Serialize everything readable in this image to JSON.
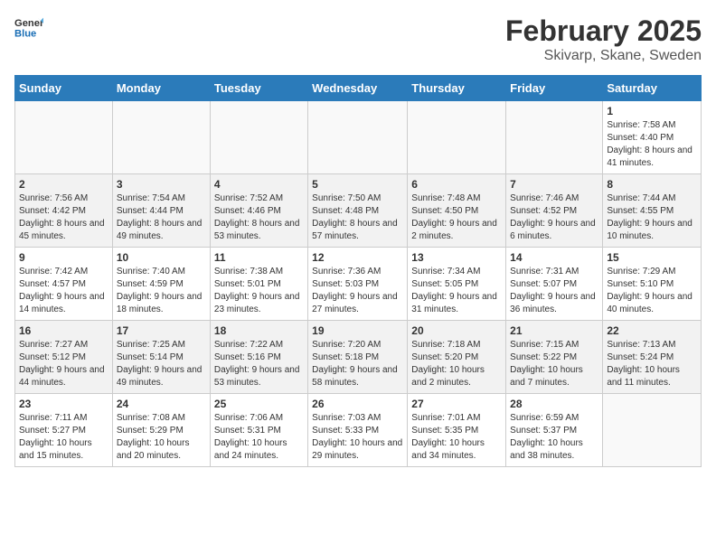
{
  "header": {
    "logo_general": "General",
    "logo_blue": "Blue",
    "month": "February 2025",
    "location": "Skivarp, Skane, Sweden"
  },
  "weekdays": [
    "Sunday",
    "Monday",
    "Tuesday",
    "Wednesday",
    "Thursday",
    "Friday",
    "Saturday"
  ],
  "weeks": [
    [
      {
        "day": "",
        "info": ""
      },
      {
        "day": "",
        "info": ""
      },
      {
        "day": "",
        "info": ""
      },
      {
        "day": "",
        "info": ""
      },
      {
        "day": "",
        "info": ""
      },
      {
        "day": "",
        "info": ""
      },
      {
        "day": "1",
        "info": "Sunrise: 7:58 AM\nSunset: 4:40 PM\nDaylight: 8 hours and 41 minutes."
      }
    ],
    [
      {
        "day": "2",
        "info": "Sunrise: 7:56 AM\nSunset: 4:42 PM\nDaylight: 8 hours and 45 minutes."
      },
      {
        "day": "3",
        "info": "Sunrise: 7:54 AM\nSunset: 4:44 PM\nDaylight: 8 hours and 49 minutes."
      },
      {
        "day": "4",
        "info": "Sunrise: 7:52 AM\nSunset: 4:46 PM\nDaylight: 8 hours and 53 minutes."
      },
      {
        "day": "5",
        "info": "Sunrise: 7:50 AM\nSunset: 4:48 PM\nDaylight: 8 hours and 57 minutes."
      },
      {
        "day": "6",
        "info": "Sunrise: 7:48 AM\nSunset: 4:50 PM\nDaylight: 9 hours and 2 minutes."
      },
      {
        "day": "7",
        "info": "Sunrise: 7:46 AM\nSunset: 4:52 PM\nDaylight: 9 hours and 6 minutes."
      },
      {
        "day": "8",
        "info": "Sunrise: 7:44 AM\nSunset: 4:55 PM\nDaylight: 9 hours and 10 minutes."
      }
    ],
    [
      {
        "day": "9",
        "info": "Sunrise: 7:42 AM\nSunset: 4:57 PM\nDaylight: 9 hours and 14 minutes."
      },
      {
        "day": "10",
        "info": "Sunrise: 7:40 AM\nSunset: 4:59 PM\nDaylight: 9 hours and 18 minutes."
      },
      {
        "day": "11",
        "info": "Sunrise: 7:38 AM\nSunset: 5:01 PM\nDaylight: 9 hours and 23 minutes."
      },
      {
        "day": "12",
        "info": "Sunrise: 7:36 AM\nSunset: 5:03 PM\nDaylight: 9 hours and 27 minutes."
      },
      {
        "day": "13",
        "info": "Sunrise: 7:34 AM\nSunset: 5:05 PM\nDaylight: 9 hours and 31 minutes."
      },
      {
        "day": "14",
        "info": "Sunrise: 7:31 AM\nSunset: 5:07 PM\nDaylight: 9 hours and 36 minutes."
      },
      {
        "day": "15",
        "info": "Sunrise: 7:29 AM\nSunset: 5:10 PM\nDaylight: 9 hours and 40 minutes."
      }
    ],
    [
      {
        "day": "16",
        "info": "Sunrise: 7:27 AM\nSunset: 5:12 PM\nDaylight: 9 hours and 44 minutes."
      },
      {
        "day": "17",
        "info": "Sunrise: 7:25 AM\nSunset: 5:14 PM\nDaylight: 9 hours and 49 minutes."
      },
      {
        "day": "18",
        "info": "Sunrise: 7:22 AM\nSunset: 5:16 PM\nDaylight: 9 hours and 53 minutes."
      },
      {
        "day": "19",
        "info": "Sunrise: 7:20 AM\nSunset: 5:18 PM\nDaylight: 9 hours and 58 minutes."
      },
      {
        "day": "20",
        "info": "Sunrise: 7:18 AM\nSunset: 5:20 PM\nDaylight: 10 hours and 2 minutes."
      },
      {
        "day": "21",
        "info": "Sunrise: 7:15 AM\nSunset: 5:22 PM\nDaylight: 10 hours and 7 minutes."
      },
      {
        "day": "22",
        "info": "Sunrise: 7:13 AM\nSunset: 5:24 PM\nDaylight: 10 hours and 11 minutes."
      }
    ],
    [
      {
        "day": "23",
        "info": "Sunrise: 7:11 AM\nSunset: 5:27 PM\nDaylight: 10 hours and 15 minutes."
      },
      {
        "day": "24",
        "info": "Sunrise: 7:08 AM\nSunset: 5:29 PM\nDaylight: 10 hours and 20 minutes."
      },
      {
        "day": "25",
        "info": "Sunrise: 7:06 AM\nSunset: 5:31 PM\nDaylight: 10 hours and 24 minutes."
      },
      {
        "day": "26",
        "info": "Sunrise: 7:03 AM\nSunset: 5:33 PM\nDaylight: 10 hours and 29 minutes."
      },
      {
        "day": "27",
        "info": "Sunrise: 7:01 AM\nSunset: 5:35 PM\nDaylight: 10 hours and 34 minutes."
      },
      {
        "day": "28",
        "info": "Sunrise: 6:59 AM\nSunset: 5:37 PM\nDaylight: 10 hours and 38 minutes."
      },
      {
        "day": "",
        "info": ""
      }
    ]
  ]
}
